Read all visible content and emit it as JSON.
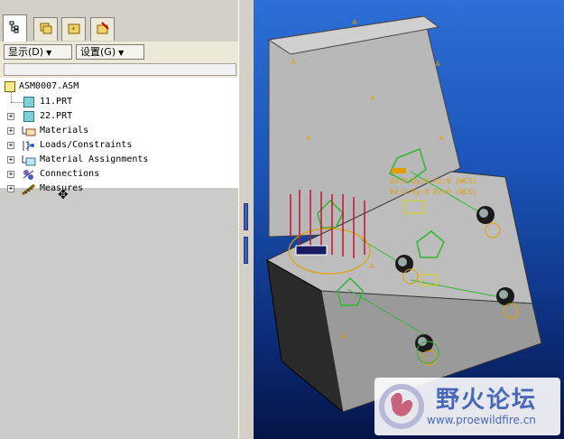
{
  "tabs": [
    {
      "icon": "model-tree-icon"
    },
    {
      "icon": "folder-browser-icon"
    },
    {
      "icon": "favorites-icon"
    },
    {
      "icon": "connections-icon"
    }
  ],
  "toolbar": {
    "show_label": "显示(D)",
    "settings_label": "设置(G)"
  },
  "tree": {
    "root": "ASM0007.ASM",
    "items": [
      {
        "label": "11.PRT",
        "icon": "part-icon",
        "expandable": false
      },
      {
        "label": "22.PRT",
        "icon": "part-icon",
        "expandable": true
      },
      {
        "label": "Materials",
        "icon": "materials-icon",
        "expandable": true
      },
      {
        "label": "Loads/Constraints",
        "icon": "loads-constraints-icon",
        "expandable": true
      },
      {
        "label": "Material Assignments",
        "icon": "material-assignments-icon",
        "expandable": true
      },
      {
        "label": "Connections",
        "icon": "connections-icon",
        "expandable": true
      },
      {
        "label": "Measures",
        "icon": "measures-icon",
        "expandable": true
      }
    ]
  },
  "viewport": {
    "coord_text_1": "Dx:0 Dy:0 Dz:0 (WCS)",
    "coord_text_2": "Rx:0 Ry:0 Rz:0 (WCS)"
  },
  "watermark": {
    "title": "野火论坛",
    "url": "www.proewildfire.cn"
  },
  "colors": {
    "background_top": "#2c6fd6",
    "background_bottom": "#051446",
    "model_face": "#b4b4b4",
    "constraint_green": "#2fb62f",
    "load_red": "#c8102e",
    "annotation_orange": "#e0a000"
  }
}
